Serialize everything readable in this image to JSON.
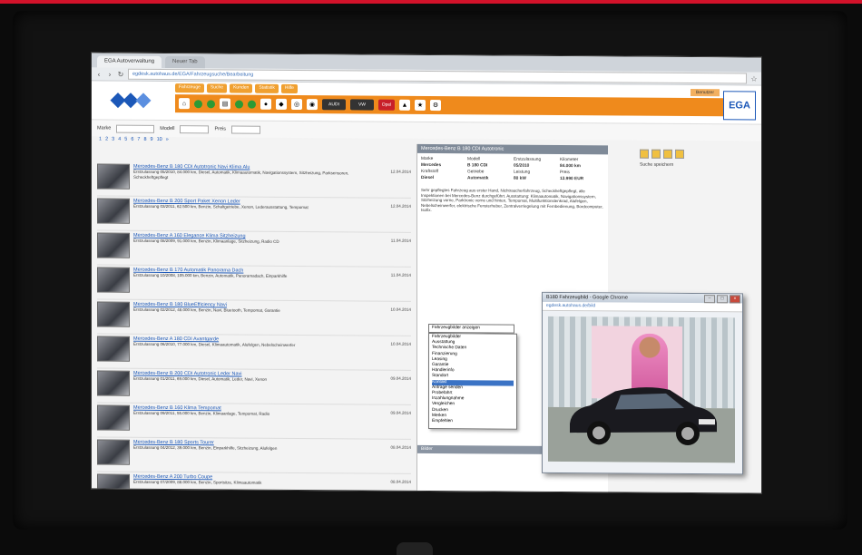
{
  "browser": {
    "tabs": [
      "EGA Autoverwaltung",
      "Neuer Tab"
    ],
    "url": "egdesk.autohaus.de/EGA/Fahrzeugsuche/Bearbeitung"
  },
  "app": {
    "logo_text": "EGA",
    "menu": [
      "Fahrzeuge",
      "Suche",
      "Kunden",
      "Statistik",
      "Hilfe"
    ],
    "user_label": "Benutzer",
    "toolbar_badges": [
      "AUDI",
      "VW",
      "Opel"
    ]
  },
  "filters": {
    "label1": "Marke",
    "label2": "Modell",
    "label3": "Preis",
    "pager": [
      "1",
      "2",
      "3",
      "4",
      "5",
      "6",
      "7",
      "8",
      "9",
      "10",
      "»"
    ]
  },
  "results": [
    {
      "title": "Mercedes-Benz B 180 CDI Autotronic Navi Klima Alu",
      "desc": "Erstzulassung 05/2010, 84.000 km, Diesel, Automatik, Klimaautomatik, Navigationssystem, Sitzheizung, Parksensoren, Scheckheftgepflegt",
      "date": "12.04.2014"
    },
    {
      "title": "Mercedes-Benz B 200 Sport Paket Xenon Leder",
      "desc": "Erstzulassung 03/2011, 62.500 km, Benzin, Schaltgetriebe, Xenon, Lederausstattung, Tempomat",
      "date": "12.04.2014"
    },
    {
      "title": "Mercedes-Benz A 160 Elegance Klima Sitzheizung",
      "desc": "Erstzulassung 08/2009, 91.000 km, Benzin, Klimaanlage, Sitzheizung, Radio CD",
      "date": "11.04.2014"
    },
    {
      "title": "Mercedes-Benz B 170 Automatik Panorama Dach",
      "desc": "Erstzulassung 10/2008, 105.000 km, Benzin, Automatik, Panoramadach, Einparkhilfe",
      "date": "11.04.2014"
    },
    {
      "title": "Mercedes-Benz B 180 BlueEfficiency Navi",
      "desc": "Erstzulassung 02/2012, 48.000 km, Benzin, Navi, Bluetooth, Tempomat, Garantie",
      "date": "10.04.2014"
    },
    {
      "title": "Mercedes-Benz A 180 CDI Avantgarde",
      "desc": "Erstzulassung 06/2010, 77.000 km, Diesel, Klimaautomatik, Alufelgen, Nebelscheinwerfer",
      "date": "10.04.2014"
    },
    {
      "title": "Mercedes-Benz B 200 CDI Autotronic Leder Navi",
      "desc": "Erstzulassung 01/2011, 69.000 km, Diesel, Automatik, Leder, Navi, Xenon",
      "date": "09.04.2014"
    },
    {
      "title": "Mercedes-Benz B 160 Klima Tempomat",
      "desc": "Erstzulassung 09/2011, 55.000 km, Benzin, Klimaanlage, Tempomat, Radio",
      "date": "09.04.2014"
    },
    {
      "title": "Mercedes-Benz B 180 Sports Tourer",
      "desc": "Erstzulassung 04/2012, 39.000 km, Benzin, Einparkhilfe, Sitzheizung, Alufelgen",
      "date": "08.04.2014"
    },
    {
      "title": "Mercedes-Benz A 200 Turbo Coupe",
      "desc": "Erstzulassung 07/2009, 88.000 km, Benzin, Sportsitze, Klimaautomatik",
      "date": "08.04.2014"
    }
  ],
  "detail": {
    "header": "Mercedes-Benz B 180 CDI Autotronic",
    "fields": [
      "Marke",
      "Modell",
      "Erstzulassung",
      "Kilometer",
      "Mercedes",
      "B 180 CDI",
      "05/2010",
      "84.000 km",
      "Kraftstoff",
      "Getriebe",
      "Leistung",
      "Preis",
      "Diesel",
      "Automatik",
      "80 kW",
      "13.990 EUR"
    ],
    "text": "Sehr gepflegtes Fahrzeug aus erster Hand, Nichtraucherfahrzeug, Scheckheftgepflegt, alle Inspektionen bei Mercedes-Benz durchgeführt. Ausstattung: Klimaautomatik, Navigationssystem, Sitzheizung vorne, Parktronic vorne und hinten, Tempomat, Multifunktionslenkrad, Alufelgen, Nebelscheinwerfer, elektrische Fensterheber, Zentralverriegelung mit Fernbedienung, Bordcomputer, Isofix.",
    "select_value": "Fahrzeugbilder anzeigen",
    "dropdown": [
      "Fahrzeugbilder",
      "Ausstattung",
      "Technische Daten",
      "Finanzierung",
      "Leasing",
      "Garantie",
      "Händlerinfo",
      "Standort",
      "Kontakt",
      "Anfrage senden",
      "Probefahrt",
      "Inzahlungnahme",
      "Vergleichen",
      "Drucken",
      "Merken",
      "Empfehlen"
    ],
    "sub_header": "Bilder"
  },
  "side": {
    "label": "Suche speichern"
  },
  "popup": {
    "title": "B180 Fahrzeugbild - Google Chrome",
    "url": "egdesk.autohaus.de/bild"
  }
}
